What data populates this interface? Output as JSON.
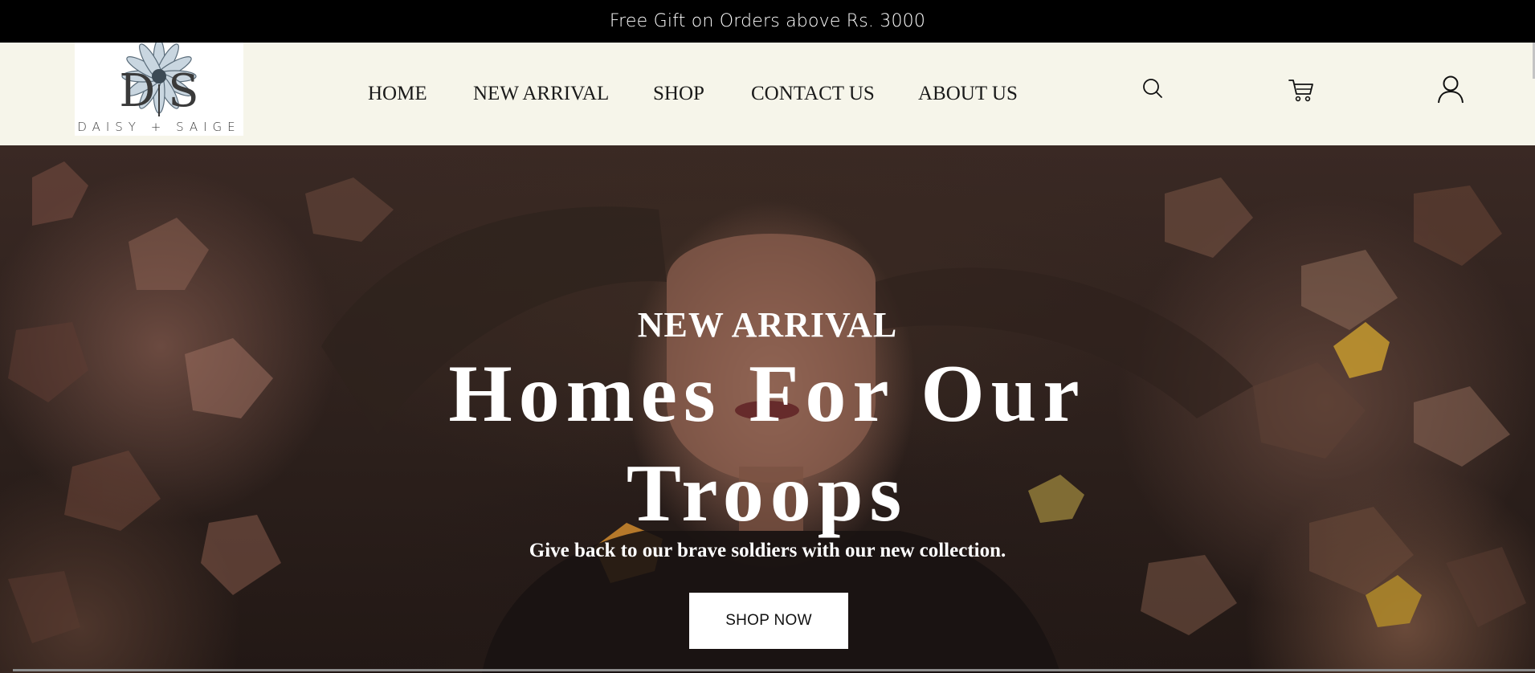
{
  "announcement": {
    "text": "Free Gift on Orders above Rs. 3000"
  },
  "brand": {
    "monogram_left": "D",
    "monogram_right": "S",
    "wordmark": "DAISY + SAIGE"
  },
  "nav": {
    "items": [
      {
        "label": "HOME"
      },
      {
        "label": "NEW ARRIVAL"
      },
      {
        "label": "SHOP"
      },
      {
        "label": "CONTACT US"
      },
      {
        "label": "ABOUT US"
      }
    ]
  },
  "header_icons": {
    "search": "search-icon",
    "cart": "cart-icon",
    "account": "user-icon"
  },
  "hero": {
    "eyebrow": "NEW ARRIVAL",
    "headline": "Homes For Our Troops",
    "subline": "Give back to our brave soldiers with our new collection.",
    "cta_label": "SHOP NOW"
  },
  "colors": {
    "announcement_bg": "#000000",
    "header_bg": "#f6f5ea",
    "hero_text": "#ffffff",
    "cta_bg": "#ffffff"
  }
}
